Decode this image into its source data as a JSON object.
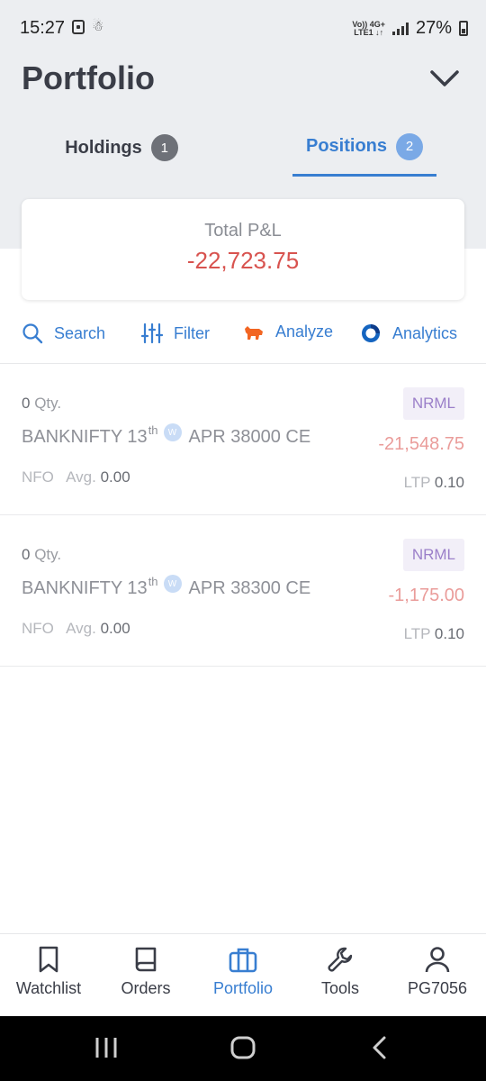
{
  "status_bar": {
    "time": "15:27",
    "network_top": "Vo)) 4G+",
    "network_bottom": "LTE1 ↓↑",
    "battery": "27%"
  },
  "header": {
    "title": "Portfolio",
    "tabs": [
      {
        "label": "Holdings",
        "count": "1",
        "active": false
      },
      {
        "label": "Positions",
        "count": "2",
        "active": true
      }
    ]
  },
  "summary": {
    "label": "Total P&L",
    "value": "-22,723.75"
  },
  "toolbar": {
    "search": "Search",
    "filter": "Filter",
    "analyze": "Analyze",
    "analytics": "Analytics"
  },
  "positions": [
    {
      "qty": "0",
      "qty_label": "Qty.",
      "product": "NRML",
      "symbol": "BANKNIFTY 13",
      "sup": "th",
      "weekly": "W",
      "expiry_strike": "APR 38000 CE",
      "pnl": "-21,548.75",
      "exchange": "NFO",
      "avg_label": "Avg.",
      "avg": "0.00",
      "ltp_label": "LTP",
      "ltp": "0.10"
    },
    {
      "qty": "0",
      "qty_label": "Qty.",
      "product": "NRML",
      "symbol": "BANKNIFTY 13",
      "sup": "th",
      "weekly": "W",
      "expiry_strike": "APR 38300 CE",
      "pnl": "-1,175.00",
      "exchange": "NFO",
      "avg_label": "Avg.",
      "avg": "0.00",
      "ltp_label": "LTP",
      "ltp": "0.10"
    }
  ],
  "bottom_nav": [
    {
      "label": "Watchlist",
      "icon": "bookmark-icon",
      "active": false
    },
    {
      "label": "Orders",
      "icon": "book-icon",
      "active": false
    },
    {
      "label": "Portfolio",
      "icon": "briefcase-icon",
      "active": true
    },
    {
      "label": "Tools",
      "icon": "wrench-icon",
      "active": false
    },
    {
      "label": "PG7056",
      "icon": "user-icon",
      "active": false
    }
  ],
  "colors": {
    "accent": "#387ed1",
    "loss": "#d8534f",
    "product_badge": "#9b7fc9"
  }
}
